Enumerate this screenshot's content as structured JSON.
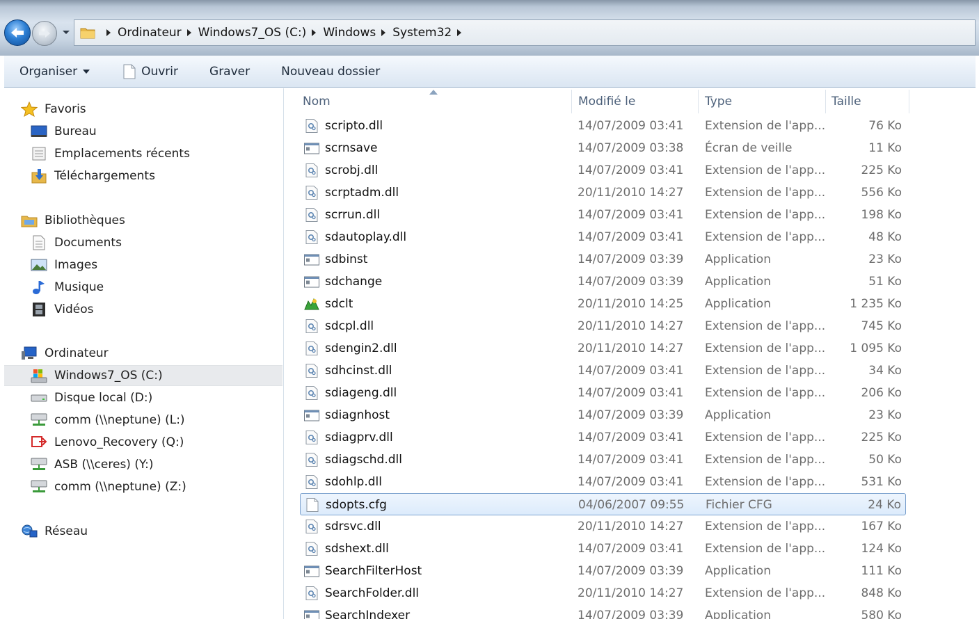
{
  "address": {
    "crumbs": [
      "Ordinateur",
      "Windows7_OS (C:)",
      "Windows",
      "System32"
    ]
  },
  "toolbar": {
    "organize_label": "Organiser",
    "open_label": "Ouvrir",
    "burn_label": "Graver",
    "new_folder_label": "Nouveau dossier"
  },
  "nav": {
    "favorites": {
      "label": "Favoris",
      "items": [
        "Bureau",
        "Emplacements récents",
        "Téléchargements"
      ]
    },
    "libraries": {
      "label": "Bibliothèques",
      "items": [
        "Documents",
        "Images",
        "Musique",
        "Vidéos"
      ]
    },
    "computer": {
      "label": "Ordinateur",
      "items": [
        "Windows7_OS (C:)",
        "Disque local (D:)",
        "comm (\\\\neptune) (L:)",
        "Lenovo_Recovery (Q:)",
        "ASB (\\\\ceres) (Y:)",
        "comm (\\\\neptune) (Z:)"
      ],
      "selected_index": 0
    },
    "network": {
      "label": "Réseau"
    }
  },
  "columns": {
    "name": "Nom",
    "modified": "Modifié le",
    "type": "Type",
    "size": "Taille"
  },
  "files": [
    {
      "name": "scripto.dll",
      "modified": "14/07/2009 03:41",
      "type": "Extension de l'app...",
      "size": "76 Ko",
      "icon": "dll-icon"
    },
    {
      "name": "scrnsave",
      "modified": "14/07/2009 03:38",
      "type": "Écran de veille",
      "size": "11 Ko",
      "icon": "app-window-icon"
    },
    {
      "name": "scrobj.dll",
      "modified": "14/07/2009 03:41",
      "type": "Extension de l'app...",
      "size": "225 Ko",
      "icon": "dll-icon"
    },
    {
      "name": "scrptadm.dll",
      "modified": "20/11/2010 14:27",
      "type": "Extension de l'app...",
      "size": "556 Ko",
      "icon": "dll-icon"
    },
    {
      "name": "scrrun.dll",
      "modified": "14/07/2009 03:41",
      "type": "Extension de l'app...",
      "size": "198 Ko",
      "icon": "dll-icon"
    },
    {
      "name": "sdautoplay.dll",
      "modified": "14/07/2009 03:41",
      "type": "Extension de l'app...",
      "size": "48 Ko",
      "icon": "dll-icon"
    },
    {
      "name": "sdbinst",
      "modified": "14/07/2009 03:39",
      "type": "Application",
      "size": "23 Ko",
      "icon": "app-window-icon"
    },
    {
      "name": "sdchange",
      "modified": "14/07/2009 03:39",
      "type": "Application",
      "size": "51 Ko",
      "icon": "app-window-icon"
    },
    {
      "name": "sdclt",
      "modified": "20/11/2010 14:25",
      "type": "Application",
      "size": "1 235 Ko",
      "icon": "backup-app-icon"
    },
    {
      "name": "sdcpl.dll",
      "modified": "20/11/2010 14:27",
      "type": "Extension de l'app...",
      "size": "745 Ko",
      "icon": "dll-icon"
    },
    {
      "name": "sdengin2.dll",
      "modified": "20/11/2010 14:27",
      "type": "Extension de l'app...",
      "size": "1 095 Ko",
      "icon": "dll-icon"
    },
    {
      "name": "sdhcinst.dll",
      "modified": "14/07/2009 03:41",
      "type": "Extension de l'app...",
      "size": "34 Ko",
      "icon": "dll-icon"
    },
    {
      "name": "sdiageng.dll",
      "modified": "14/07/2009 03:41",
      "type": "Extension de l'app...",
      "size": "206 Ko",
      "icon": "dll-icon"
    },
    {
      "name": "sdiagnhost",
      "modified": "14/07/2009 03:39",
      "type": "Application",
      "size": "23 Ko",
      "icon": "app-window-icon"
    },
    {
      "name": "sdiagprv.dll",
      "modified": "14/07/2009 03:41",
      "type": "Extension de l'app...",
      "size": "225 Ko",
      "icon": "dll-icon"
    },
    {
      "name": "sdiagschd.dll",
      "modified": "14/07/2009 03:41",
      "type": "Extension de l'app...",
      "size": "50 Ko",
      "icon": "dll-icon"
    },
    {
      "name": "sdohlp.dll",
      "modified": "14/07/2009 03:41",
      "type": "Extension de l'app...",
      "size": "531 Ko",
      "icon": "dll-icon"
    },
    {
      "name": "sdopts.cfg",
      "modified": "04/06/2007 09:55",
      "type": "Fichier CFG",
      "size": "24 Ko",
      "icon": "blank-file-icon",
      "selected": true
    },
    {
      "name": "sdrsvc.dll",
      "modified": "20/11/2010 14:27",
      "type": "Extension de l'app...",
      "size": "167 Ko",
      "icon": "dll-icon"
    },
    {
      "name": "sdshext.dll",
      "modified": "14/07/2009 03:41",
      "type": "Extension de l'app...",
      "size": "124 Ko",
      "icon": "dll-icon"
    },
    {
      "name": "SearchFilterHost",
      "modified": "14/07/2009 03:39",
      "type": "Application",
      "size": "111 Ko",
      "icon": "app-window-icon"
    },
    {
      "name": "SearchFolder.dll",
      "modified": "20/11/2010 14:27",
      "type": "Extension de l'app...",
      "size": "848 Ko",
      "icon": "dll-icon"
    },
    {
      "name": "SearchIndexer",
      "modified": "14/07/2009 03:39",
      "type": "Application",
      "size": "580 Ko",
      "icon": "app-window-icon"
    }
  ]
}
